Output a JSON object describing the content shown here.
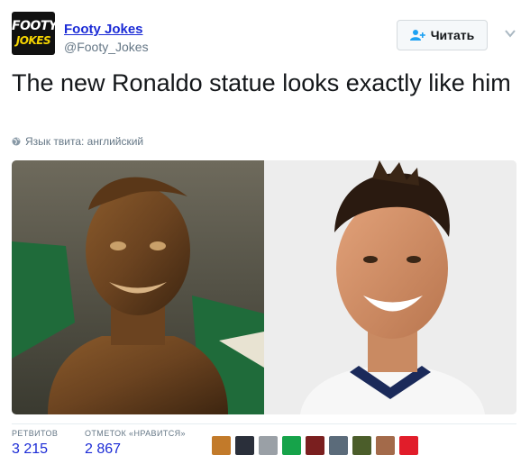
{
  "author": {
    "avatar_line1": "FOOTY",
    "avatar_line2": "JOKES",
    "name": "Footy Jokes",
    "handle": "@Footy_Jokes"
  },
  "follow_button": {
    "label": "Читать",
    "icon": "add-user-icon"
  },
  "menu_icon": "chevron-down-icon",
  "tweet": {
    "text": "The new Ronaldo statue looks exactly like him",
    "language_note": "Язык твита: английский",
    "language_icon": "globe-icon"
  },
  "media": {
    "left_alt": "bronze bust statue",
    "right_alt": "smiling man photo"
  },
  "stats": {
    "retweets_label": "РЕТВИТОВ",
    "retweets_value": "3 215",
    "likes_label": "ОТМЕТОК «НРАВИТСЯ»",
    "likes_value": "2 867"
  },
  "likers": [
    {
      "color": "#c27a2a"
    },
    {
      "color": "#2a2f3a"
    },
    {
      "color": "#9aa0a6"
    },
    {
      "color": "#16a34a"
    },
    {
      "color": "#7a1f1f"
    },
    {
      "color": "#5b6b7a"
    },
    {
      "color": "#4b5d2a"
    },
    {
      "color": "#a36a4a"
    },
    {
      "color": "#e11d2a"
    }
  ],
  "colors": {
    "link": "#1b2bd6",
    "muted": "#657786",
    "accent": "#1da1f2"
  }
}
